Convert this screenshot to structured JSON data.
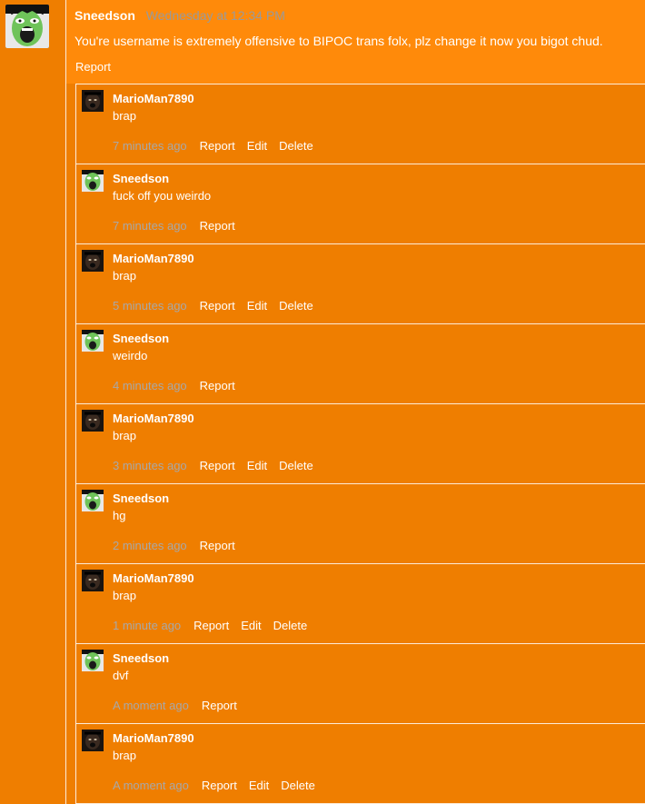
{
  "colors": {
    "background": "#ef7e00",
    "main_post_bg": "#ff8a0a",
    "text": "#ffffff",
    "muted": "#9a9a9a"
  },
  "main_post": {
    "author": "Sneedson",
    "timestamp": "Wednesday at 12:34 PM",
    "message": "You're username is extremely offensive to BIPOC trans folx, plz change it now you bigot chud.",
    "actions": {
      "report": "Report"
    },
    "avatar_icon": "green-screaming-face-avatar"
  },
  "comments": [
    {
      "author": "MarioMan7890",
      "text": "brap",
      "time": "7 minutes ago",
      "report": "Report",
      "edit": "Edit",
      "delete": "Delete",
      "avatar": "dark"
    },
    {
      "author": "Sneedson",
      "text": "fuck off you weirdo",
      "time": "7 minutes ago",
      "report": "Report",
      "edit": "",
      "delete": "",
      "avatar": "green"
    },
    {
      "author": "MarioMan7890",
      "text": "brap",
      "time": "5 minutes ago",
      "report": "Report",
      "edit": "Edit",
      "delete": "Delete",
      "avatar": "dark"
    },
    {
      "author": "Sneedson",
      "text": "weirdo",
      "time": "4 minutes ago",
      "report": "Report",
      "edit": "",
      "delete": "",
      "avatar": "green"
    },
    {
      "author": "MarioMan7890",
      "text": "brap",
      "time": "3 minutes ago",
      "report": "Report",
      "edit": "Edit",
      "delete": "Delete",
      "avatar": "dark"
    },
    {
      "author": "Sneedson",
      "text": "hg",
      "time": "2 minutes ago",
      "report": "Report",
      "edit": "",
      "delete": "",
      "avatar": "green"
    },
    {
      "author": "MarioMan7890",
      "text": "brap",
      "time": "1 minute ago",
      "report": "Report",
      "edit": "Edit",
      "delete": "Delete",
      "avatar": "dark"
    },
    {
      "author": "Sneedson",
      "text": "dvf",
      "time": "A moment ago",
      "report": "Report",
      "edit": "",
      "delete": "",
      "avatar": "green"
    },
    {
      "author": "MarioMan7890",
      "text": "brap",
      "time": "A moment ago",
      "report": "Report",
      "edit": "Edit",
      "delete": "Delete",
      "avatar": "dark"
    }
  ]
}
